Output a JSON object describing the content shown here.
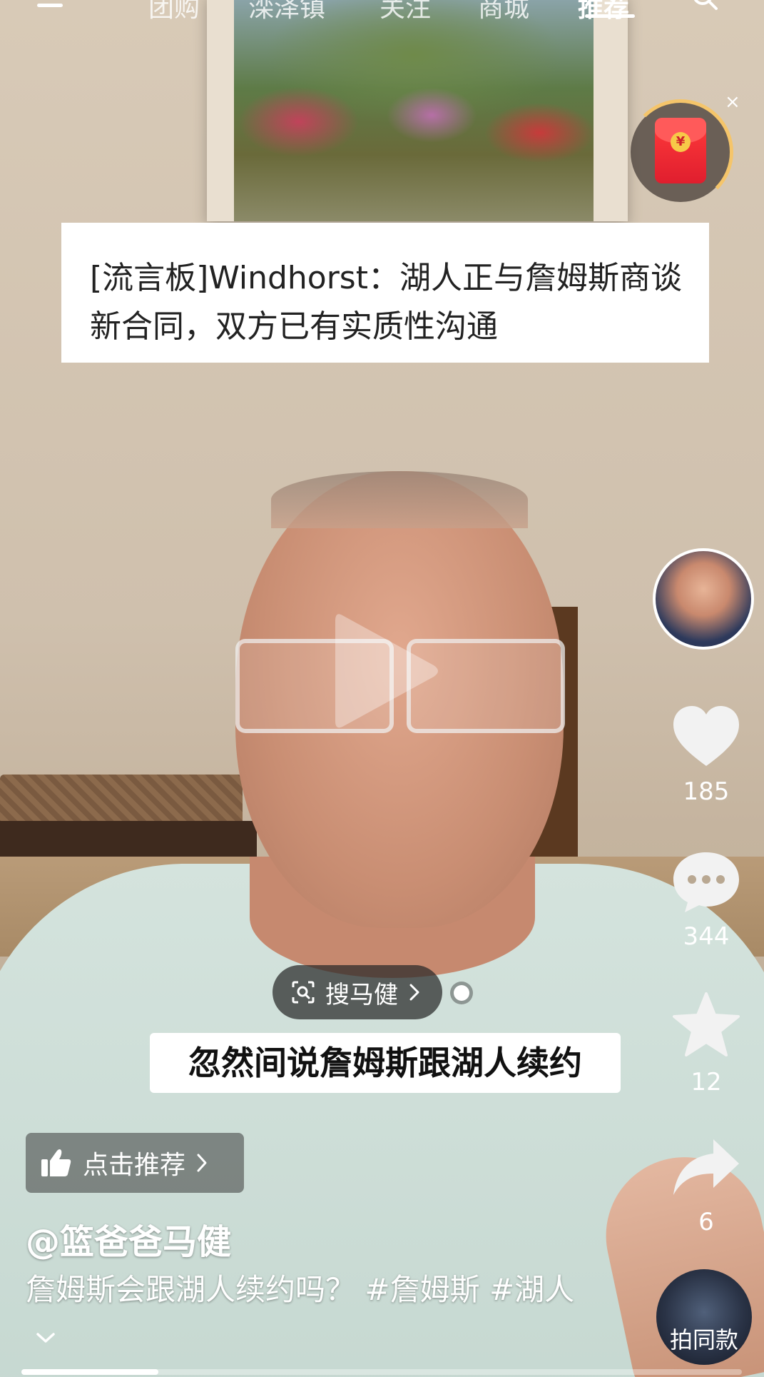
{
  "nav": {
    "tabs": [
      {
        "label": "团购"
      },
      {
        "label": "滦泽镇"
      },
      {
        "label": "关注"
      },
      {
        "label": "商城"
      },
      {
        "label": "推荐",
        "active": true
      }
    ],
    "menu_icon": "hamburger-menu-icon",
    "search_icon": "search-icon"
  },
  "red_packet": {
    "icon": "red-envelope-icon",
    "coin_symbol": "¥",
    "close_symbol": "×"
  },
  "headline": {
    "text": "[流言板]Windhorst：湖人正与詹姆斯商谈新合同，双方已有实质性沟通"
  },
  "video": {
    "play_icon": "play-icon",
    "progress": 0.19
  },
  "rail": {
    "like": {
      "icon": "heart-icon",
      "count": "185"
    },
    "comment": {
      "icon": "comment-icon",
      "count": "344"
    },
    "favorite": {
      "icon": "star-icon",
      "count": "12"
    },
    "share": {
      "icon": "share-arrow-icon",
      "count": "6"
    },
    "remix": {
      "label": "拍同款"
    }
  },
  "search_pill": {
    "label": "搜马健",
    "icon": "visual-search-icon"
  },
  "subtitle": {
    "text": "忽然间说詹姆斯跟湖人续约"
  },
  "recommend": {
    "label": "点击推荐",
    "icon": "thumbs-up-icon"
  },
  "author": {
    "name": "@篮爸爸马健"
  },
  "description": {
    "text": "詹姆斯会跟湖人续约吗？",
    "tags": [
      "#詹姆斯",
      "#湖人"
    ]
  },
  "colors": {
    "accent_red": "#e01e2e",
    "gold": "#f5c56a",
    "white": "#ffffff"
  }
}
